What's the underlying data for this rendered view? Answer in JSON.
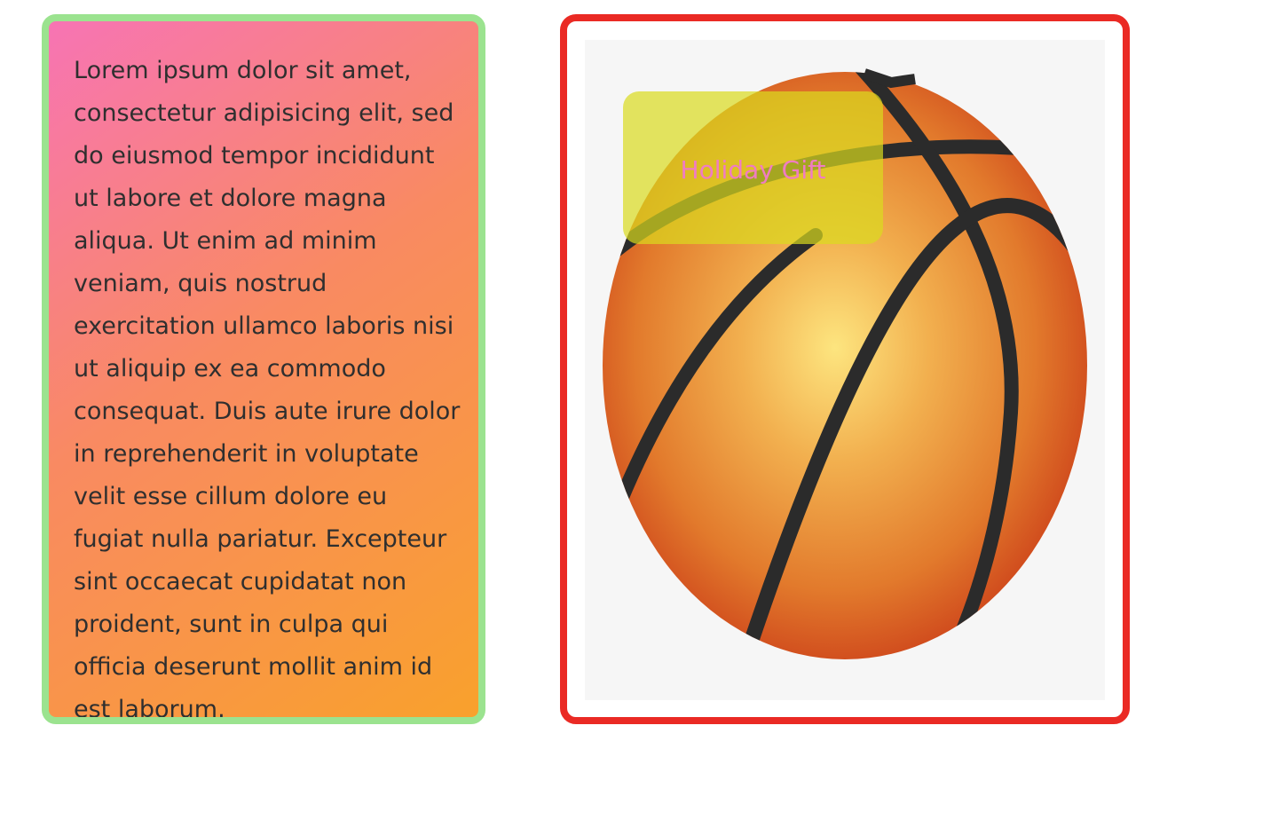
{
  "text_card": {
    "body": "Lorem ipsum dolor sit amet, consectetur adipisicing elit, sed do eiusmod tempor incididunt ut labore et dolore magna aliqua. Ut enim ad minim veniam, quis nostrud exercitation ullamco laboris nisi ut aliquip ex ea commodo consequat. Duis aute irure dolor in reprehenderit in voluptate velit esse cillum dolore eu fugiat nulla pariatur. Excepteur sint occaecat cupidatat non proident, sunt in culpa qui officia deserunt mollit anim id est laborum."
  },
  "image_card": {
    "image_subject": "basketball-illustration",
    "badge_label": "Holiday Gift"
  },
  "colors": {
    "text_card_border": "#9be38f",
    "text_card_gradient_start": "#f774b4",
    "text_card_gradient_end": "#f9a12c",
    "image_frame_border": "#ea2a24",
    "badge_background": "#dadc1e",
    "badge_text": "#f07cc2"
  }
}
